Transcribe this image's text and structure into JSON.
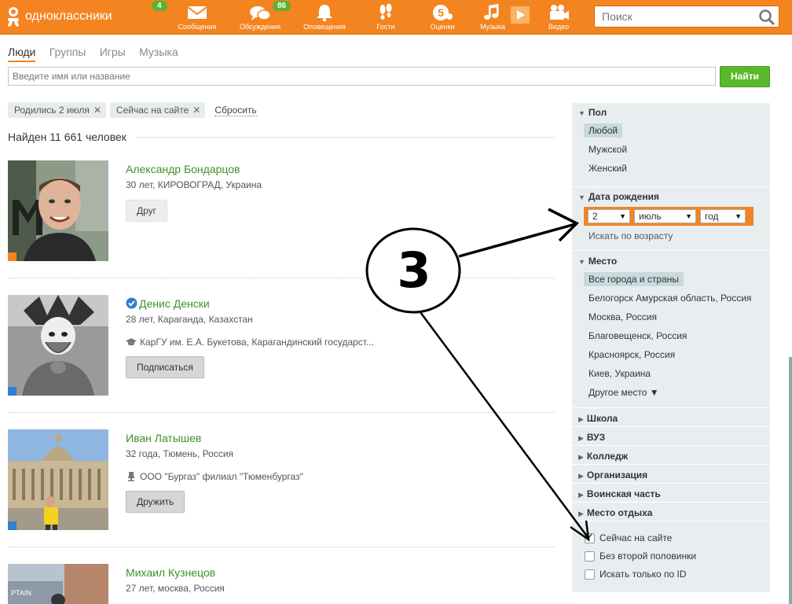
{
  "header": {
    "logo_text": "одноклассники",
    "logo_badge": "4",
    "nav": [
      {
        "label": "Сообщения",
        "icon": "envelope-icon",
        "badge": ""
      },
      {
        "label": "Обсуждения",
        "icon": "chat-bubbles-icon",
        "badge": "86"
      },
      {
        "label": "Оповещения",
        "icon": "bell-icon",
        "badge": ""
      },
      {
        "label": "Гости",
        "icon": "footprints-icon",
        "badge": ""
      },
      {
        "label": "Оценки",
        "icon": "rating-5-icon",
        "badge": ""
      },
      {
        "label": "Музыка",
        "icon": "music-note-icon",
        "badge": ""
      },
      {
        "label": "Видео",
        "icon": "video-camera-icon",
        "badge": ""
      }
    ],
    "search_placeholder": "Поиск"
  },
  "tabs": [
    "Люди",
    "Группы",
    "Игры",
    "Музыка"
  ],
  "active_tab": "Люди",
  "search": {
    "placeholder": "Введите имя или название",
    "button": "Найти"
  },
  "filters": {
    "chips": [
      "Родились 2 июля",
      "Сейчас на сайте"
    ],
    "reset": "Сбросить"
  },
  "results": {
    "count_text": "Найден 11 661 человек",
    "people": [
      {
        "name": "Александр Бондарцов",
        "meta": "30 лет, КИРОВОГРАД, Украина",
        "extra": "",
        "extra_icon": "",
        "verified": false,
        "button": "Друг",
        "status_color": "#f48420"
      },
      {
        "name": "Денис Денски",
        "meta": "28 лет, Караганда, Казахстан",
        "extra": "КарГУ им. Е.А. Букетова, Карагандинский государст...",
        "extra_icon": "graduation-cap-icon",
        "verified": true,
        "button": "Подписаться",
        "status_color": "#2f80d0"
      },
      {
        "name": "Иван Латышев",
        "meta": "32 года, Тюмень, Россия",
        "extra": "ООО \"Бургаз\" филиал \"Тюменбургаз\"",
        "extra_icon": "office-chair-icon",
        "verified": false,
        "button": "Дружить",
        "status_color": "#2f80d0"
      },
      {
        "name": "Михаил Кузнецов",
        "meta": "27 лет, москва, Россия",
        "extra": "",
        "extra_icon": "",
        "verified": false,
        "button": "",
        "status_color": ""
      }
    ]
  },
  "sidebar": {
    "gender": {
      "title": "Пол",
      "options": [
        "Любой",
        "Мужской",
        "Женский"
      ],
      "selected": "Любой"
    },
    "birthday": {
      "title": "Дата рождения",
      "day": "2",
      "month": "июль",
      "year": "год",
      "by_age": "Искать по возрасту"
    },
    "place": {
      "title": "Место",
      "options": [
        "Все города и страны",
        "Белогорск Амурская область, Россия",
        "Москва, Россия",
        "Благовещенск, Россия",
        "Красноярск, Россия",
        "Киев, Украина",
        "Другое место ▼"
      ],
      "selected": "Все города и страны"
    },
    "collapsed": [
      "Школа",
      "ВУЗ",
      "Колледж",
      "Организация",
      "Воинская часть",
      "Место отдыха"
    ],
    "checkboxes": [
      {
        "label": "Сейчас на сайте",
        "checked": true
      },
      {
        "label": "Без второй половинки",
        "checked": false
      },
      {
        "label": "Искать только по ID",
        "checked": false
      }
    ]
  },
  "annotation": {
    "label": "3"
  },
  "colors": {
    "brand_orange": "#f48420",
    "green_button": "#5cb82b",
    "name_green": "#3d9128",
    "sidebar_bg": "#e8eef0"
  }
}
